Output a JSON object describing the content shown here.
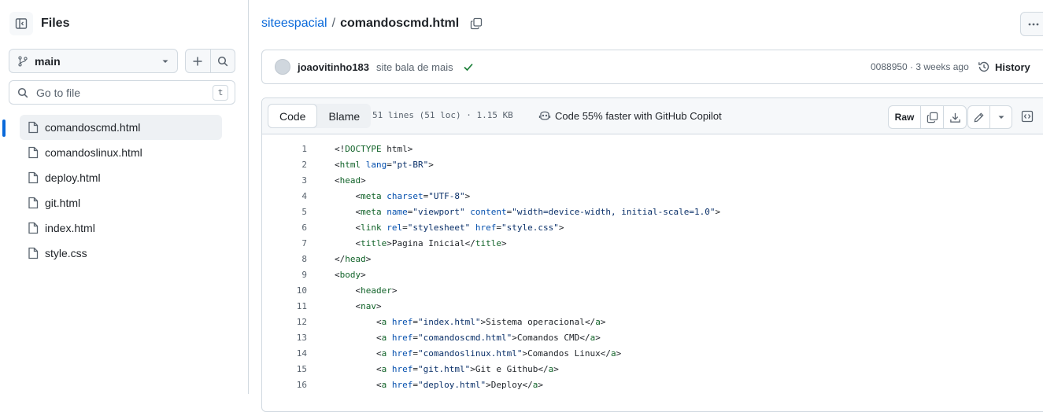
{
  "sidebar": {
    "title": "Files",
    "branch": "main",
    "search_placeholder": "Go to file",
    "search_shortcut": "t",
    "files": [
      "comandoscmd.html",
      "comandoslinux.html",
      "deploy.html",
      "git.html",
      "index.html",
      "style.css"
    ],
    "active_file_index": 0
  },
  "breadcrumb": {
    "repo": "siteespacial",
    "separator": "/",
    "file": "comandoscmd.html"
  },
  "commit": {
    "author": "joaovitinho183",
    "message": "site bala de mais",
    "sha_time": "0088950 · 3 weeks ago",
    "history_label": "History"
  },
  "file_header": {
    "tab_code": "Code",
    "tab_blame": "Blame",
    "meta": "51 lines (51 loc) · 1.15 KB",
    "copilot": "Code 55% faster with GitHub Copilot",
    "raw_label": "Raw"
  },
  "code_lines": [
    {
      "n": "1",
      "text": "<!DOCTYPE html>"
    },
    {
      "n": "2",
      "text": "<html lang=\"pt-BR\">"
    },
    {
      "n": "3",
      "text": "<head>"
    },
    {
      "n": "4",
      "text": "    <meta charset=\"UTF-8\">"
    },
    {
      "n": "5",
      "text": "    <meta name=\"viewport\" content=\"width=device-width, initial-scale=1.0\">"
    },
    {
      "n": "6",
      "text": "    <link rel=\"stylesheet\" href=\"style.css\">"
    },
    {
      "n": "7",
      "text": "    <title>Pagina Inicial</title>"
    },
    {
      "n": "8",
      "text": "</head>"
    },
    {
      "n": "9",
      "text": "<body>"
    },
    {
      "n": "10",
      "text": "    <header>"
    },
    {
      "n": "11",
      "text": "    <nav>"
    },
    {
      "n": "12",
      "text": "        <a href=\"index.html\">Sistema operacional</a>"
    },
    {
      "n": "13",
      "text": "        <a href=\"comandoscmd.html\">Comandos CMD</a>"
    },
    {
      "n": "14",
      "text": "        <a href=\"comandoslinux.html\">Comandos Linux</a>"
    },
    {
      "n": "15",
      "text": "        <a href=\"git.html\">Git e Github</a>"
    },
    {
      "n": "16",
      "text": "        <a href=\"deploy.html\">Deploy</a>"
    }
  ],
  "colors": {
    "link": "#0969da",
    "success": "#1a7f37",
    "border": "#d1d9e0",
    "muted": "#59636e"
  }
}
